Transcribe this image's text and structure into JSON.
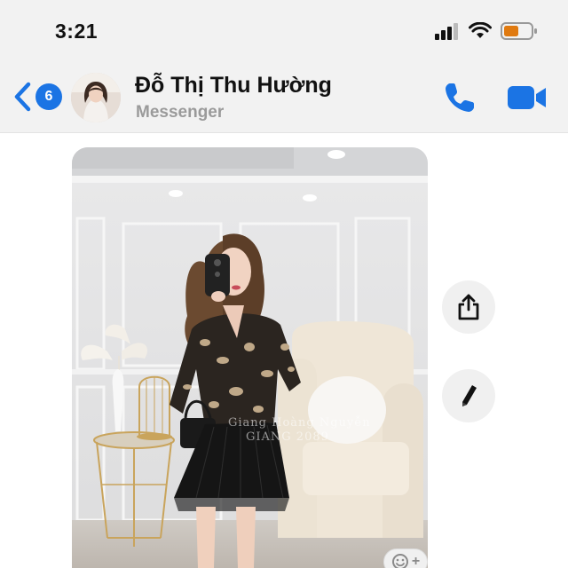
{
  "status_bar": {
    "time": "3:21",
    "icons": [
      "cellular-signal-icon",
      "wifi-icon",
      "battery-low-icon"
    ],
    "battery_color": "#e07a10"
  },
  "header": {
    "back_badge": "6",
    "contact_name": "Đỗ Thị Thu Hường",
    "subtitle": "Messenger",
    "accent_color": "#1b74e4",
    "icons": [
      "back-chevron-icon",
      "phone-call-icon",
      "video-camera-icon"
    ]
  },
  "message": {
    "watermark_line1": "Giang Hoàng Nguyễn",
    "watermark_line2": "GIANG 2089"
  },
  "side_actions": {
    "icons": [
      "share-icon",
      "edit-pencil-icon"
    ]
  },
  "reaction_chip": {
    "icons": [
      "smiley-add-icon"
    ],
    "plus": "+"
  }
}
